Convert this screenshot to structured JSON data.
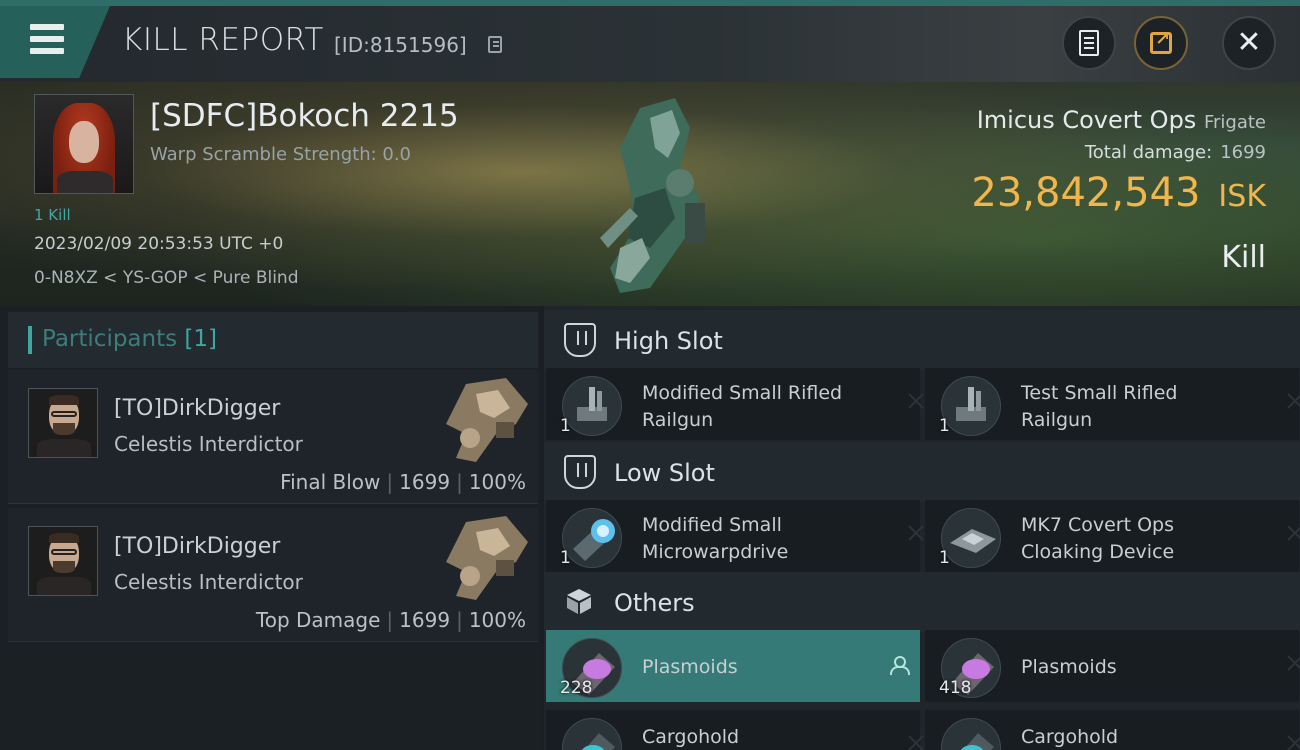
{
  "header": {
    "title": "KILL REPORT",
    "report_id": "[ID:8151596]"
  },
  "victim": {
    "name": "[SDFC]Bokoch 2215",
    "warp_scramble": "Warp Scramble Strength: 0.0",
    "kill_count": "1 Kill",
    "timestamp": "2023/02/09 20:53:53 UTC +0",
    "location": "0-N8XZ < YS-GOP < Pure Blind"
  },
  "ship": {
    "name": "Imicus Covert Ops",
    "class": "Frigate",
    "total_damage_label": "Total damage:",
    "total_damage": "1699",
    "isk_value": "23,842,543",
    "isk_unit": "ISK",
    "result": "Kill"
  },
  "participants": {
    "title": "Participants",
    "count": "[1]",
    "items": [
      {
        "name": "[TO]DirkDigger",
        "ship": "Celestis Interdictor",
        "role": "Final Blow",
        "damage": "1699",
        "percent": "100%"
      },
      {
        "name": "[TO]DirkDigger",
        "ship": "Celestis Interdictor",
        "role": "Top Damage",
        "damage": "1699",
        "percent": "100%"
      }
    ]
  },
  "slots": {
    "high": {
      "label": "High Slot",
      "items": [
        {
          "name": "Modified Small Rifled Railgun",
          "qty": "1"
        },
        {
          "name": "Test Small Rifled Railgun",
          "qty": "1"
        }
      ]
    },
    "low": {
      "label": "Low Slot",
      "items": [
        {
          "name": "Modified Small Microwarpdrive",
          "qty": "1"
        },
        {
          "name": "MK7 Covert Ops Cloaking Device",
          "qty": "1"
        }
      ]
    },
    "others": {
      "label": "Others",
      "items": [
        {
          "name": "Plasmoids",
          "qty": "228"
        },
        {
          "name": "Plasmoids",
          "qty": "418"
        },
        {
          "name": "Cargohold",
          "qty": ""
        },
        {
          "name": "Cargohold",
          "qty": ""
        }
      ]
    }
  },
  "colors": {
    "accent": "#3fa6a2",
    "isk": "#f0b64c",
    "selected_row": "#357a76"
  },
  "icons": [
    "menu-icon",
    "copy-icon",
    "document-icon",
    "share-icon",
    "close-icon",
    "slot-shield-icon",
    "cargo-box-icon",
    "person-icon",
    "remove-x-icon"
  ]
}
